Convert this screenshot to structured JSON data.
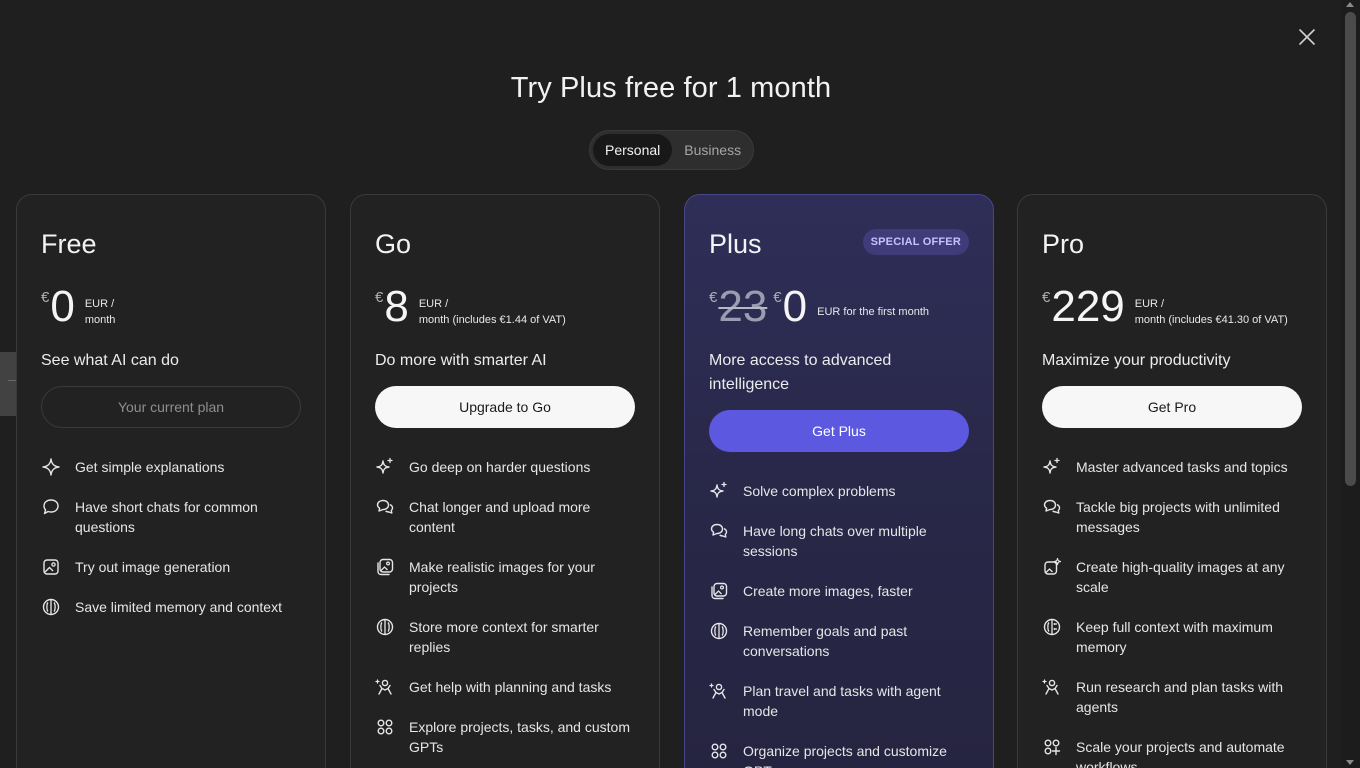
{
  "dialog": {
    "title": "Try Plus free for 1 month",
    "close_icon": "close-icon"
  },
  "toggle": {
    "options": [
      "Personal",
      "Business"
    ],
    "selected": "Personal"
  },
  "plans": [
    {
      "name": "Free",
      "currency": "€",
      "price": "0",
      "unit_line1": "EUR /",
      "unit_line2": "month",
      "tagline": "See what AI can do",
      "cta": "Your current plan",
      "features": [
        {
          "icon": "sparkle-icon",
          "text": "Get simple explanations"
        },
        {
          "icon": "chat-bubble-icon",
          "text": "Have short chats for common questions"
        },
        {
          "icon": "image-icon",
          "text": "Try out image generation"
        },
        {
          "icon": "brain-icon",
          "text": "Save limited memory and context"
        }
      ]
    },
    {
      "name": "Go",
      "currency": "€",
      "price": "8",
      "unit_line1": "EUR /",
      "unit_line2": "month (includes €1.44 of VAT)",
      "tagline": "Do more with smarter AI",
      "cta": "Upgrade to Go",
      "features": [
        {
          "icon": "sparkles-icon",
          "text": "Go deep on harder questions"
        },
        {
          "icon": "chat-bubbles-icon",
          "text": "Chat longer and upload more content"
        },
        {
          "icon": "images-icon",
          "text": "Make realistic images for your projects"
        },
        {
          "icon": "brain-icon",
          "text": "Store more context for smarter replies"
        },
        {
          "icon": "agent-icon",
          "text": "Get help with planning and tasks"
        },
        {
          "icon": "apps-icon",
          "text": "Explore projects, tasks, and custom GPTs"
        }
      ]
    },
    {
      "name": "Plus",
      "badge": "SPECIAL OFFER",
      "currency": "€",
      "old_price": "23",
      "price": "0",
      "unit_line1": "EUR for the first month",
      "tagline": "More access to advanced intelligence",
      "cta": "Get Plus",
      "features": [
        {
          "icon": "sparkles-icon",
          "text": "Solve complex problems"
        },
        {
          "icon": "chat-bubbles-icon",
          "text": "Have long chats over multiple sessions"
        },
        {
          "icon": "images-icon",
          "text": "Create more images, faster"
        },
        {
          "icon": "brain-icon",
          "text": "Remember goals and past conversations"
        },
        {
          "icon": "agent-icon",
          "text": "Plan travel and tasks with agent mode"
        },
        {
          "icon": "apps-icon",
          "text": "Organize projects and customize GPTs"
        }
      ]
    },
    {
      "name": "Pro",
      "currency": "€",
      "price": "229",
      "unit_line1": "EUR /",
      "unit_line2": "month (includes €41.30 of VAT)",
      "tagline": "Maximize your productivity",
      "cta": "Get Pro",
      "features": [
        {
          "icon": "sparkles-icon",
          "text": "Master advanced tasks and topics"
        },
        {
          "icon": "chat-bubbles-icon",
          "text": "Tackle big projects with unlimited messages"
        },
        {
          "icon": "images-sparkle-icon",
          "text": "Create high-quality images at any scale"
        },
        {
          "icon": "brain-circuit-icon",
          "text": "Keep full context with maximum memory"
        },
        {
          "icon": "agent-icon",
          "text": "Run research and plan tasks with agents"
        },
        {
          "icon": "apps-plus-icon",
          "text": "Scale your projects and automate workflows"
        }
      ]
    }
  ],
  "colors": {
    "background": "#1f1f1f",
    "card": "#222222",
    "plus_card": "#2f2e58",
    "accent": "#5c59e0",
    "badge_text": "#c6c2ff"
  }
}
